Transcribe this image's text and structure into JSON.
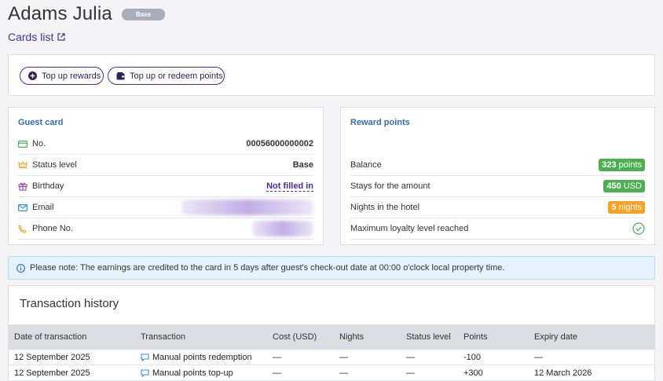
{
  "header": {
    "name": "Adams Julia",
    "status_badge": "Base",
    "cards_link": "Cards list"
  },
  "actions": {
    "top_up_rewards": "Top up rewards",
    "top_up_or_redeem": "Top up or redeem points"
  },
  "guest_card": {
    "title": "Guest card",
    "rows": [
      {
        "label": "No.",
        "value": "00056000000002",
        "icon": "card-icon"
      },
      {
        "label": "Status level",
        "value": "Base",
        "icon": "crown-icon"
      },
      {
        "label": "Birthday",
        "value": "Not filled in",
        "icon": "gift-icon"
      },
      {
        "label": "Email",
        "value": "",
        "icon": "envelope-icon"
      },
      {
        "label": "Phone No.",
        "value": "",
        "icon": "phone-icon"
      }
    ]
  },
  "reward_points": {
    "title": "Reward points",
    "balance": {
      "label": "Balance",
      "value": "323",
      "unit": "points",
      "color": "#4caf50"
    },
    "stays": {
      "label": "Stays for the amount",
      "value": "450",
      "unit": "USD",
      "color": "#4caf50"
    },
    "nights": {
      "label": "Nights in the hotel",
      "value": "5",
      "unit": "nights",
      "color": "#f7a023"
    },
    "max_level": {
      "label": "Maximum loyalty level reached",
      "icon": "check-circle-icon"
    }
  },
  "notice": "Please note: The earnings are credited to the card in 5 days after guest's check-out date at 00:00 o'clock local property time.",
  "transactions": {
    "title": "Transaction history",
    "columns": [
      "Date of transaction",
      "Transaction",
      "Cost (USD)",
      "Nights",
      "Status level",
      "Points",
      "Expiry date"
    ],
    "rows": [
      {
        "date": "12 September 2025",
        "transaction": "Manual points redemption",
        "cost": "—",
        "nights": "—",
        "status": "—",
        "points": "-100",
        "expiry": "—"
      },
      {
        "date": "12 September 2025",
        "transaction": "Manual points top-up",
        "cost": "—",
        "nights": "—",
        "status": "—",
        "points": "+300",
        "expiry": "12 March 2026"
      }
    ]
  }
}
